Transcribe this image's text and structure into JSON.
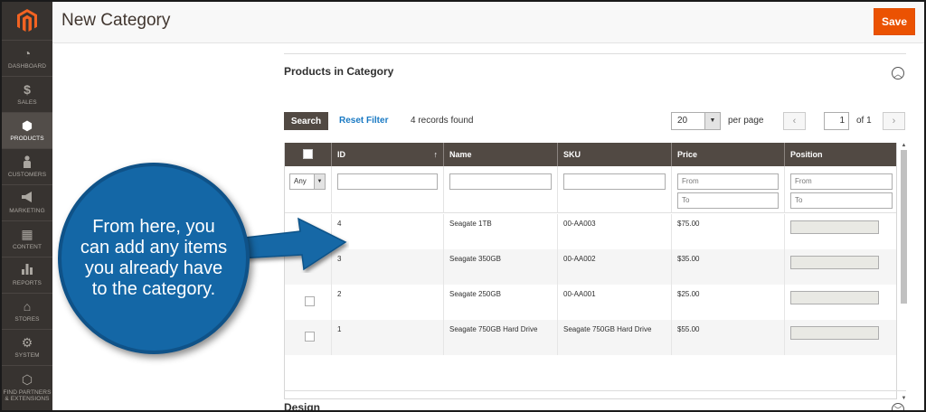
{
  "header": {
    "title": "New Category",
    "save_label": "Save"
  },
  "sidebar": {
    "items": [
      {
        "label": "DASHBOARD",
        "icon": "dashboard-icon",
        "glyph": "◔"
      },
      {
        "label": "SALES",
        "icon": "dollar-icon",
        "glyph": "$"
      },
      {
        "label": "PRODUCTS",
        "icon": "cube-icon",
        "glyph": "⬢",
        "active": true
      },
      {
        "label": "CUSTOMERS",
        "icon": "person-icon",
        "glyph": "👤"
      },
      {
        "label": "MARKETING",
        "icon": "megaphone-icon",
        "glyph": "📢"
      },
      {
        "label": "CONTENT",
        "icon": "layout-icon",
        "glyph": "▦"
      },
      {
        "label": "REPORTS",
        "icon": "bar-chart-icon",
        "glyph": "▮"
      },
      {
        "label": "STORES",
        "icon": "store-icon",
        "glyph": "⌂"
      },
      {
        "label": "SYSTEM",
        "icon": "gear-icon",
        "glyph": "⚙"
      },
      {
        "label": "FIND PARTNERS & EXTENSIONS",
        "icon": "box-icon",
        "glyph": "⬡"
      }
    ]
  },
  "section": {
    "title": "Products in Category",
    "next_title": "Design"
  },
  "toolbar": {
    "search_label": "Search",
    "reset_label": "Reset Filter",
    "records_found": "4 records found",
    "per_page_value": "20",
    "per_page_label": "per page",
    "page_value": "1",
    "page_of": "of 1"
  },
  "grid": {
    "columns": [
      "",
      "ID",
      "Name",
      "SKU",
      "Price",
      "Position"
    ],
    "sort_indicator": "↑",
    "filters": {
      "any": "Any",
      "price_from": "From",
      "price_to": "To",
      "position_from": "From",
      "position_to": "To"
    },
    "rows": [
      {
        "id": "4",
        "name": "Seagate 1TB",
        "sku": "00-AA003",
        "price": "$75.00"
      },
      {
        "id": "3",
        "name": "Seagate 350GB",
        "sku": "00-AA002",
        "price": "$35.00"
      },
      {
        "id": "2",
        "name": "Seagate 250GB",
        "sku": "00-AA001",
        "price": "$25.00"
      },
      {
        "id": "1",
        "name": "Seagate 750GB Hard Drive",
        "sku": "Seagate 750GB Hard Drive",
        "price": "$55.00"
      }
    ]
  },
  "callout": {
    "text": "From here, you can add any items you already have to the category."
  },
  "colors": {
    "accent": "#eb5202",
    "sidebar": "#373330",
    "grid_header": "#514943",
    "callout": "#1467a6",
    "link": "#1979c3"
  }
}
